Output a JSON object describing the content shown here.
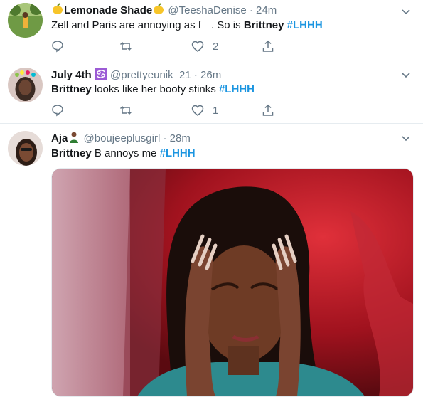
{
  "tweets": [
    {
      "display_name": "Lemonade Shade",
      "name_emoji": "lemon-emoji",
      "handle": "@TeeshaDenise",
      "separator": "·",
      "time": "24m",
      "text_before": "Zell and Paris are annoying as f",
      "text_redacted": "  ",
      "text_after": ". So is ",
      "bold": "Brittney",
      "hashtag": "#LHHH",
      "reply_count": "",
      "retweet_count": "",
      "like_count": "2"
    },
    {
      "display_name": "July 4th",
      "name_emoji": "cancer-zodiac-emoji",
      "handle": "@prettyeunik_21",
      "separator": "·",
      "time": "26m",
      "bold": "Brittney",
      "text_after": " looks like her booty stinks ",
      "hashtag": "#LHHH",
      "like_count": "1"
    },
    {
      "display_name": "Aja",
      "name_emoji": "person-emoji",
      "handle": "@boujeeplusgirl",
      "separator": "·",
      "time": "28m",
      "bold": "Brittney",
      "text_after": " B annoys me ",
      "hashtag": "#LHHH",
      "media": "gif-woman-holding-head"
    }
  ],
  "icons": {
    "reply": "reply-icon",
    "retweet": "retweet-icon",
    "like": "heart-icon",
    "share": "share-icon",
    "caret": "chevron-down-icon"
  },
  "colors": {
    "hashtag": "#1b95e0",
    "secondary_text": "#657786",
    "divider": "#e6ecf0"
  }
}
